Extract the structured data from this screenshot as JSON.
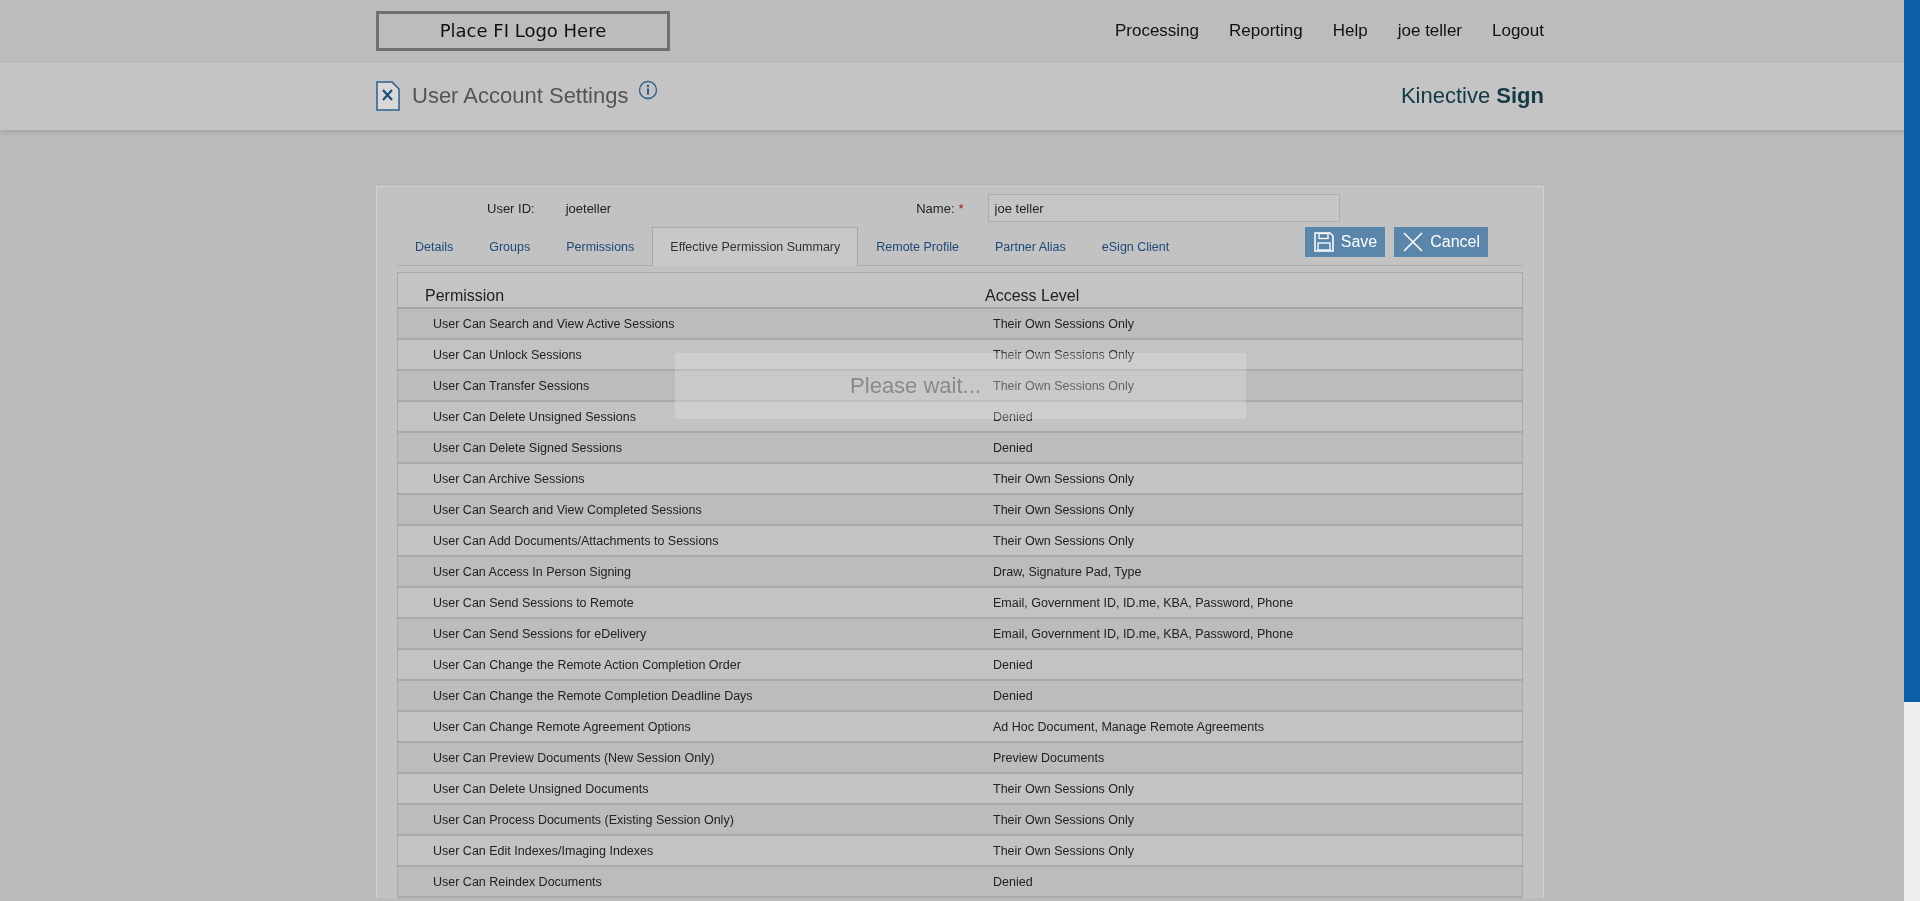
{
  "header": {
    "logo": "Place FI Logo Here",
    "nav": [
      "Processing",
      "Reporting",
      "Help",
      "joe teller",
      "Logout"
    ]
  },
  "page_title": "User Account Settings",
  "brand": {
    "text": "Kinective **Sign**"
  },
  "form": {
    "user_id_label": "User ID:",
    "user_id": "joeteller",
    "name_label": "Name:",
    "required_mark": "*",
    "name_value": "joe teller"
  },
  "tabs": [
    {
      "label": "Details",
      "selected": false
    },
    {
      "label": "Groups",
      "selected": false
    },
    {
      "label": "Permissions",
      "selected": false
    },
    {
      "label": "Effective Permission Summary",
      "selected": true
    },
    {
      "label": "Remote Profile",
      "selected": false
    },
    {
      "label": "Partner Alias",
      "selected": false
    },
    {
      "label": "eSign Client",
      "selected": false
    }
  ],
  "buttons": [
    {
      "kind": "save",
      "label": "Save"
    },
    {
      "kind": "cancel",
      "label": "Cancel"
    }
  ],
  "table": {
    "columns": [
      "Permission",
      "Access Level"
    ],
    "rows": [
      [
        "User Can Search and View Active Sessions",
        "Their Own Sessions Only"
      ],
      [
        "User Can Unlock Sessions",
        "Their Own Sessions Only"
      ],
      [
        "User Can Transfer Sessions",
        "Their Own Sessions Only"
      ],
      [
        "User Can Delete Unsigned Sessions",
        "Denied"
      ],
      [
        "User Can Delete Signed Sessions",
        "Denied"
      ],
      [
        "User Can Archive Sessions",
        "Their Own Sessions Only"
      ],
      [
        "User Can Search and View Completed Sessions",
        "Their Own Sessions Only"
      ],
      [
        "User Can Add Documents/Attachments to Sessions",
        "Their Own Sessions Only"
      ],
      [
        "User Can Access In Person Signing",
        "Draw, Signature Pad, Type"
      ],
      [
        "User Can Send Sessions to Remote",
        "Email, Government ID, ID.me, KBA, Password, Phone"
      ],
      [
        "User Can Send Sessions for eDelivery",
        "Email, Government ID, ID.me, KBA, Password, Phone"
      ],
      [
        "User Can Change the Remote Action Completion Order",
        "Denied"
      ],
      [
        "User Can Change the Remote Completion Deadline Days",
        "Denied"
      ],
      [
        "User Can Change Remote Agreement Options",
        "Ad Hoc Document, Manage Remote Agreements"
      ],
      [
        "User Can Preview Documents (New Session Only)",
        "Preview Documents"
      ],
      [
        "User Can Delete Unsigned Documents",
        "Their Own Sessions Only"
      ],
      [
        "User Can Process Documents (Existing Session Only)",
        "Their Own Sessions Only"
      ],
      [
        "User Can Edit Indexes/Imaging Indexes",
        "Their Own Sessions Only"
      ],
      [
        "User Can Reindex Documents",
        "Denied"
      ]
    ]
  },
  "loading": {
    "text": "Please wait..."
  }
}
